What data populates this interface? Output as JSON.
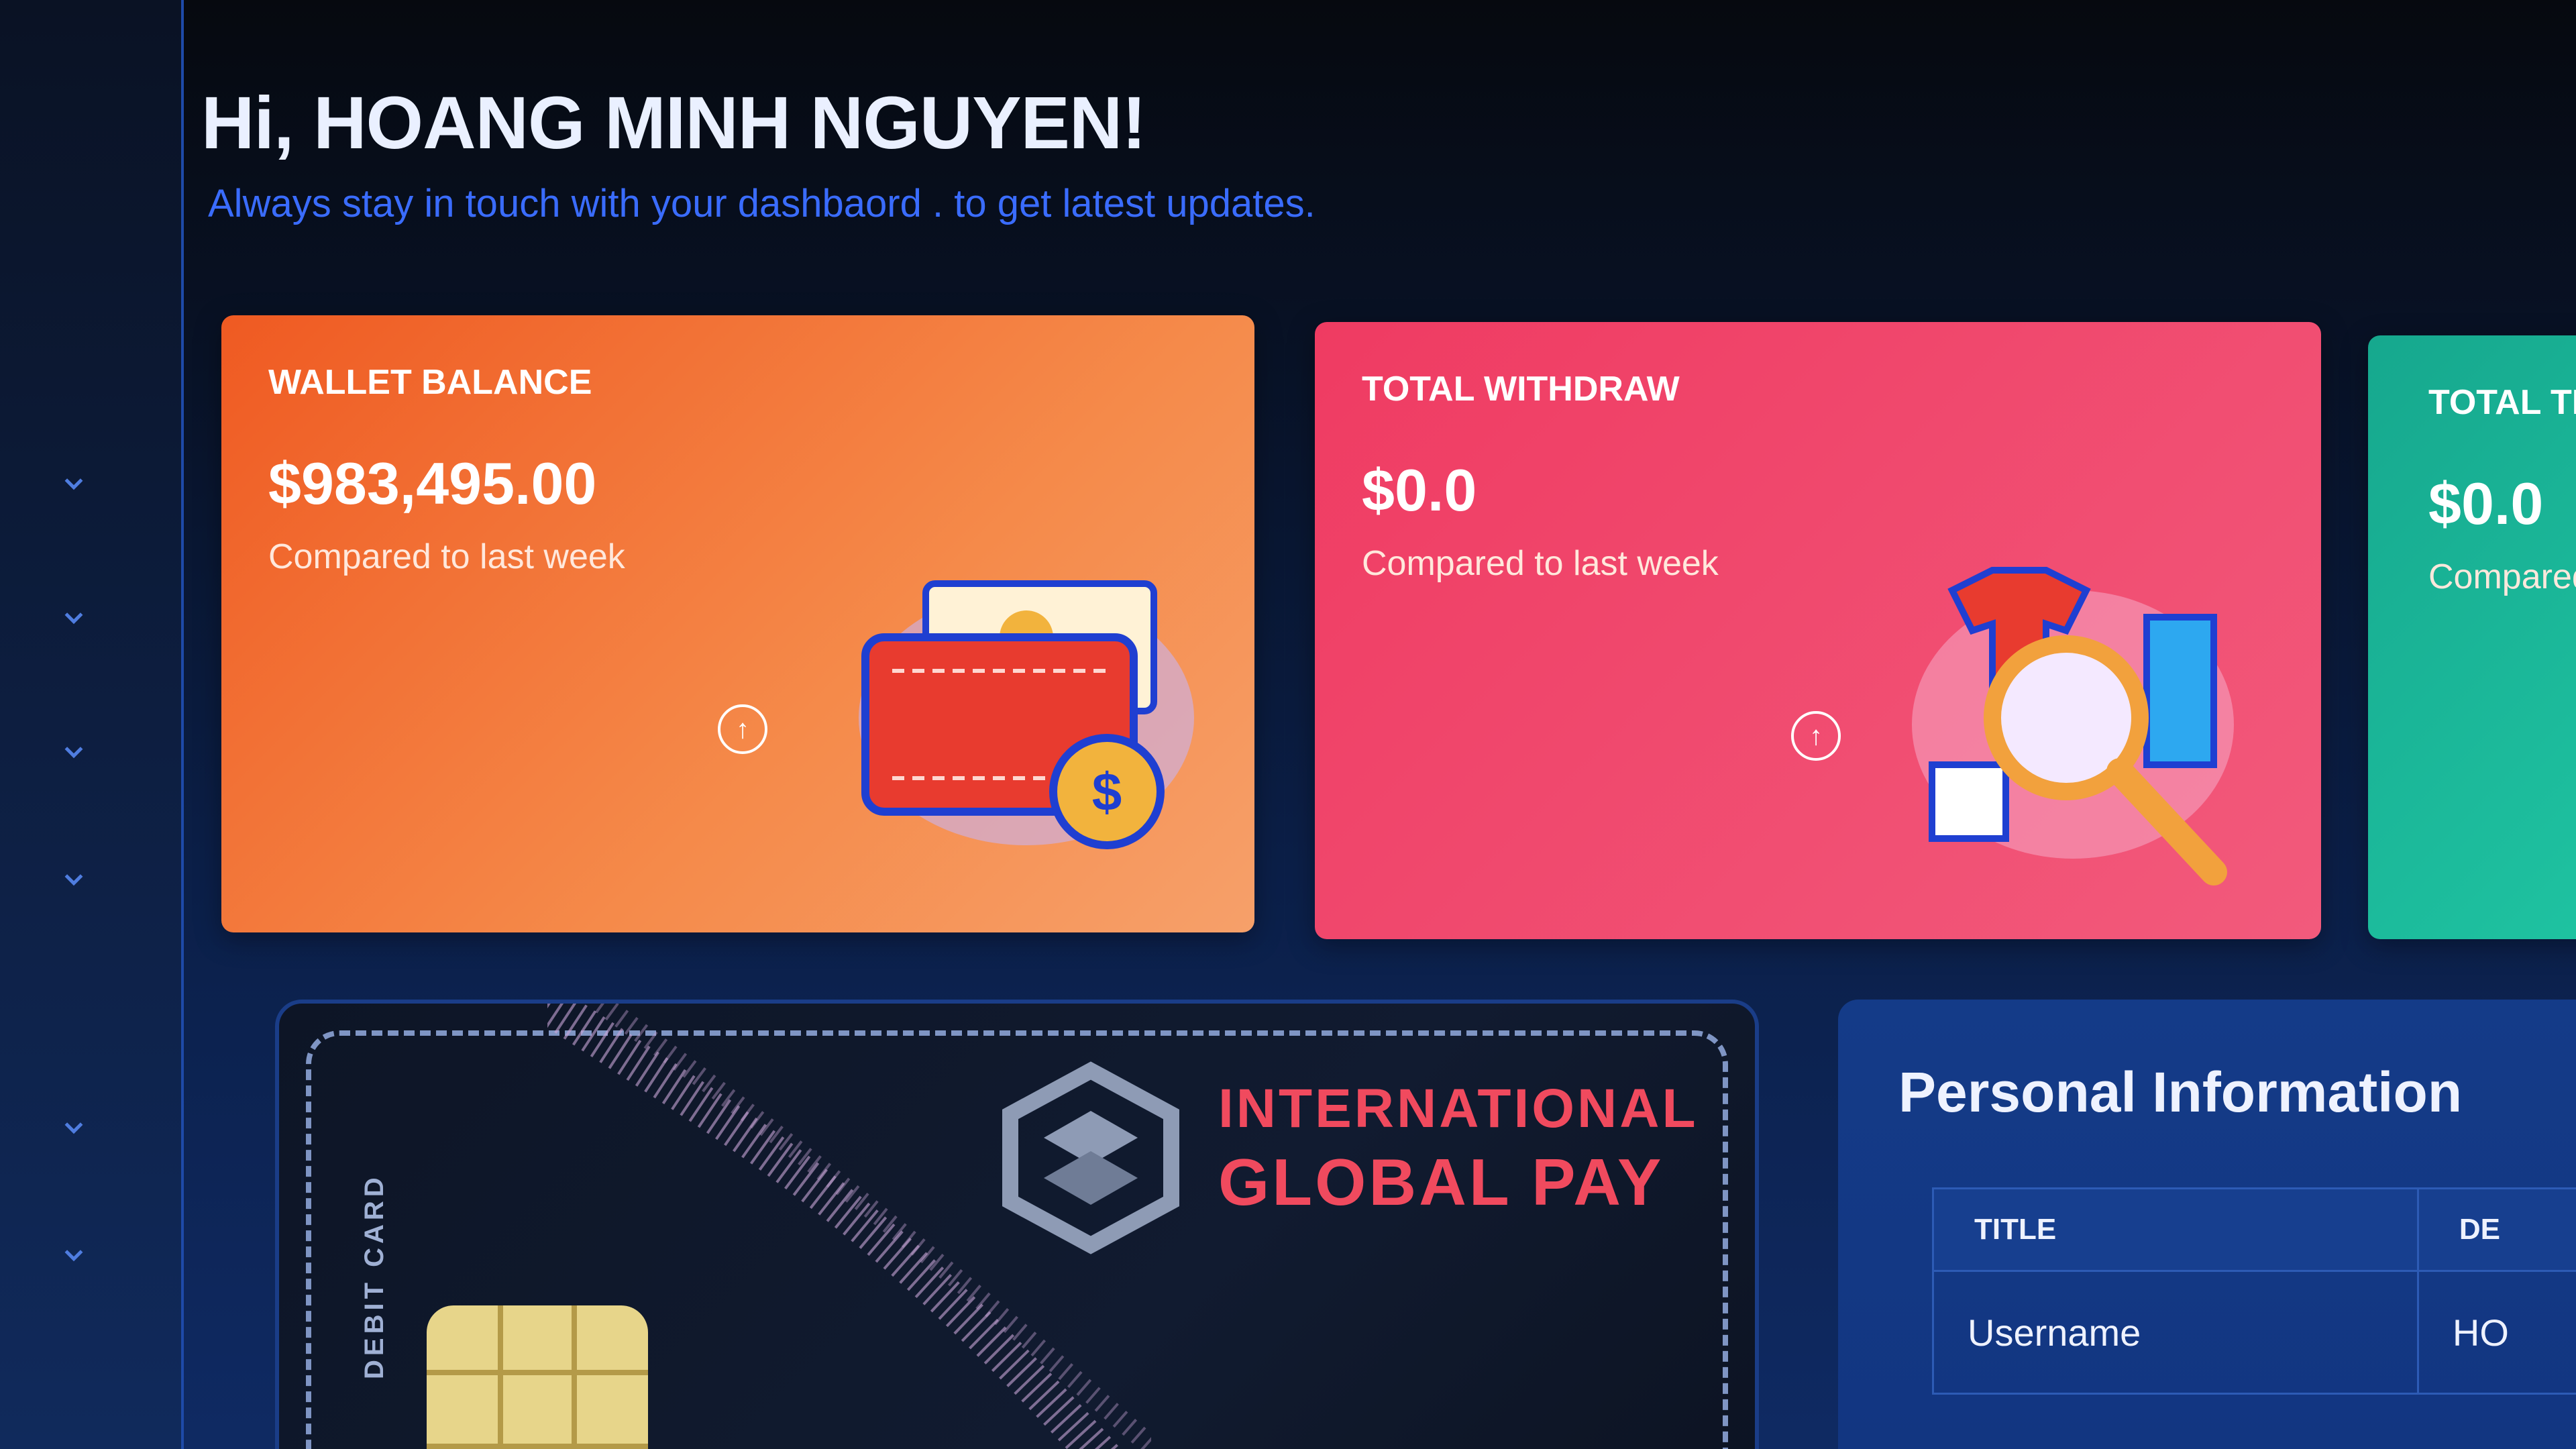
{
  "header": {
    "greeting": "Hi, HOANG MINH NGUYEN!",
    "subtitle": "Always stay in touch with your dashbaord . to get latest updates."
  },
  "cards": [
    {
      "title": "WALLET BALANCE",
      "amount": "$983,495.00",
      "compare": "Compared to last week",
      "icon": "wallet-illustration",
      "color": "#ef5a22"
    },
    {
      "title": "TOTAL WITHDRAW",
      "amount": "$0.0",
      "compare": "Compared to last week",
      "icon": "shopping-search-illustration",
      "color": "#ef3b62"
    },
    {
      "title": "TOTAL TR",
      "amount": "$0.0",
      "compare": "Compared",
      "color": "#16a88e"
    }
  ],
  "debit_card": {
    "label": "DEBIT CARD",
    "brand_line1": "INTERNATIONAL",
    "brand_line2": "GLOBAL PAY"
  },
  "personal_info": {
    "title": "Personal Information",
    "columns": [
      "TITLE",
      "DE"
    ],
    "rows": [
      {
        "title": "Username",
        "value": "HO"
      }
    ]
  },
  "sidebar": {
    "icons": [
      "chevron-down-icon"
    ]
  },
  "colors": {
    "accent": "#3a6cff",
    "brand_red": "#f04a5e"
  }
}
